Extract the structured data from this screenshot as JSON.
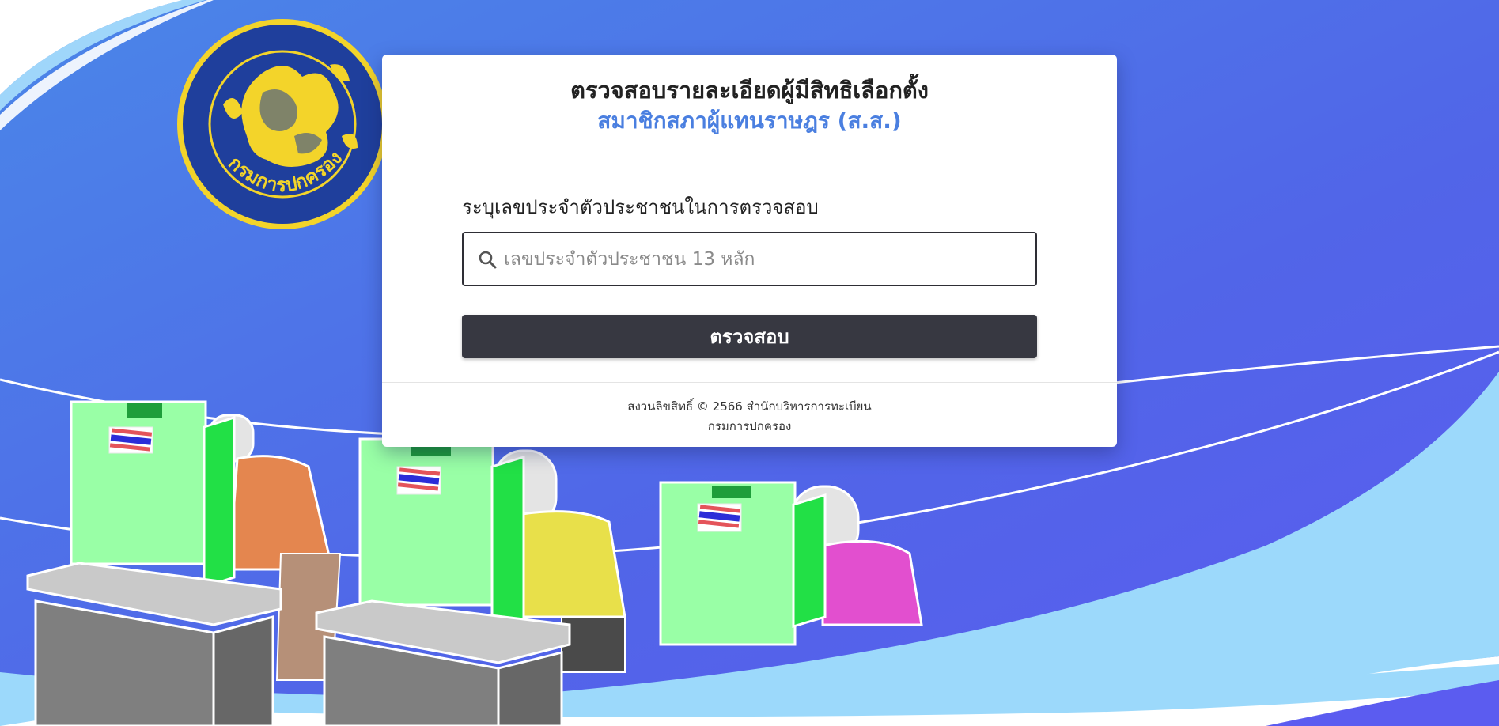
{
  "header": {
    "title": "ตรวจสอบรายละเอียดผู้มีสิทธิเลือกตั้ง",
    "subtitle": "สมาชิกสภาผู้แทนราษฎร (ส.ส.)"
  },
  "form": {
    "label": "ระบุเลขประจำตัวประชาชนในการตรวจสอบ",
    "id_input": {
      "placeholder": "เลขประจำตัวประชาชน 13 หลัก",
      "value": ""
    },
    "submit_label": "ตรวจสอบ"
  },
  "footer": {
    "copyright": "สงวนลิขสิทธิ์ © 2566 สำนักบริหารการทะเบียน",
    "department": "กรมการปกครอง"
  },
  "logo": {
    "seal_text": "กรมการปกครอง",
    "icon": "department-seal-icon"
  },
  "colors": {
    "background_blue": "#4f73e6",
    "accent_blue": "#4a7fe0",
    "light_blue": "#9dd8fb",
    "button_dark": "#373841",
    "booth_green": "#99ffa6",
    "booth_side_green": "#22e046",
    "seal_gold": "#f3d42a",
    "seal_navy": "#1f3f9c"
  }
}
